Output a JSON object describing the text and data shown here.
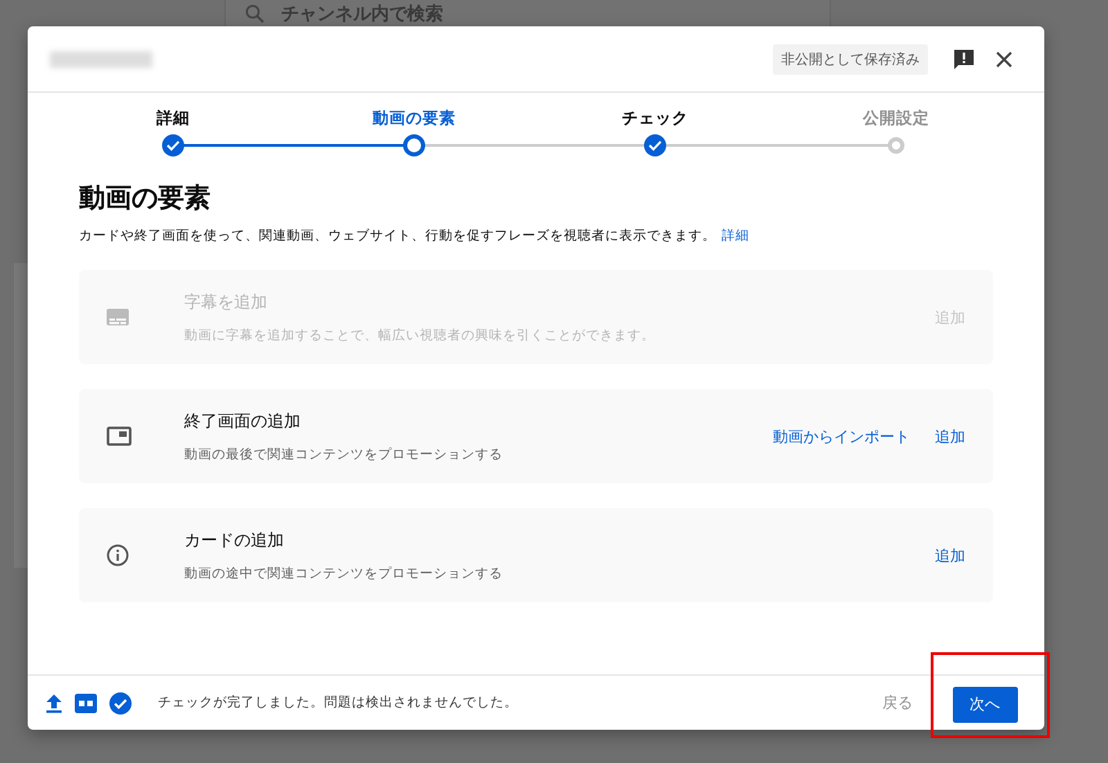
{
  "background": {
    "search": {
      "placeholder": "チャンネル内で検索"
    }
  },
  "dialog": {
    "badge": "非公開として保存済み",
    "steps": [
      {
        "label": "詳細",
        "completed": true,
        "selected": false
      },
      {
        "label": "動画の要素",
        "completed": false,
        "selected": true
      },
      {
        "label": "チェック",
        "completed": true,
        "selected": false
      },
      {
        "label": "公開設定",
        "completed": false,
        "selected": false
      }
    ],
    "heading": "動画の要素",
    "description": "カードや終了画面を使って、関連動画、ウェブサイト、行動を促すフレーズを視聴者に表示できます。",
    "description_link": "詳細",
    "items": [
      {
        "kind": "subtitles",
        "title": "字幕を追加",
        "subtitle": "動画に字幕を追加することで、幅広い視聴者の興味を引くことができます。",
        "disabled": true,
        "actions": [
          "追加"
        ]
      },
      {
        "kind": "end_screen",
        "title": "終了画面の追加",
        "subtitle": "動画の最後で関連コンテンツをプロモーションする",
        "disabled": false,
        "actions": [
          "動画からインポート",
          "追加"
        ]
      },
      {
        "kind": "cards",
        "title": "カードの追加",
        "subtitle": "動画の途中で関連コンテンツをプロモーションする",
        "disabled": false,
        "actions": [
          "追加"
        ]
      }
    ],
    "footer": {
      "status": "チェックが完了しました。問題は検出されませんでした。",
      "back": "戻る",
      "next": "次へ",
      "next_highlighted": true
    }
  }
}
